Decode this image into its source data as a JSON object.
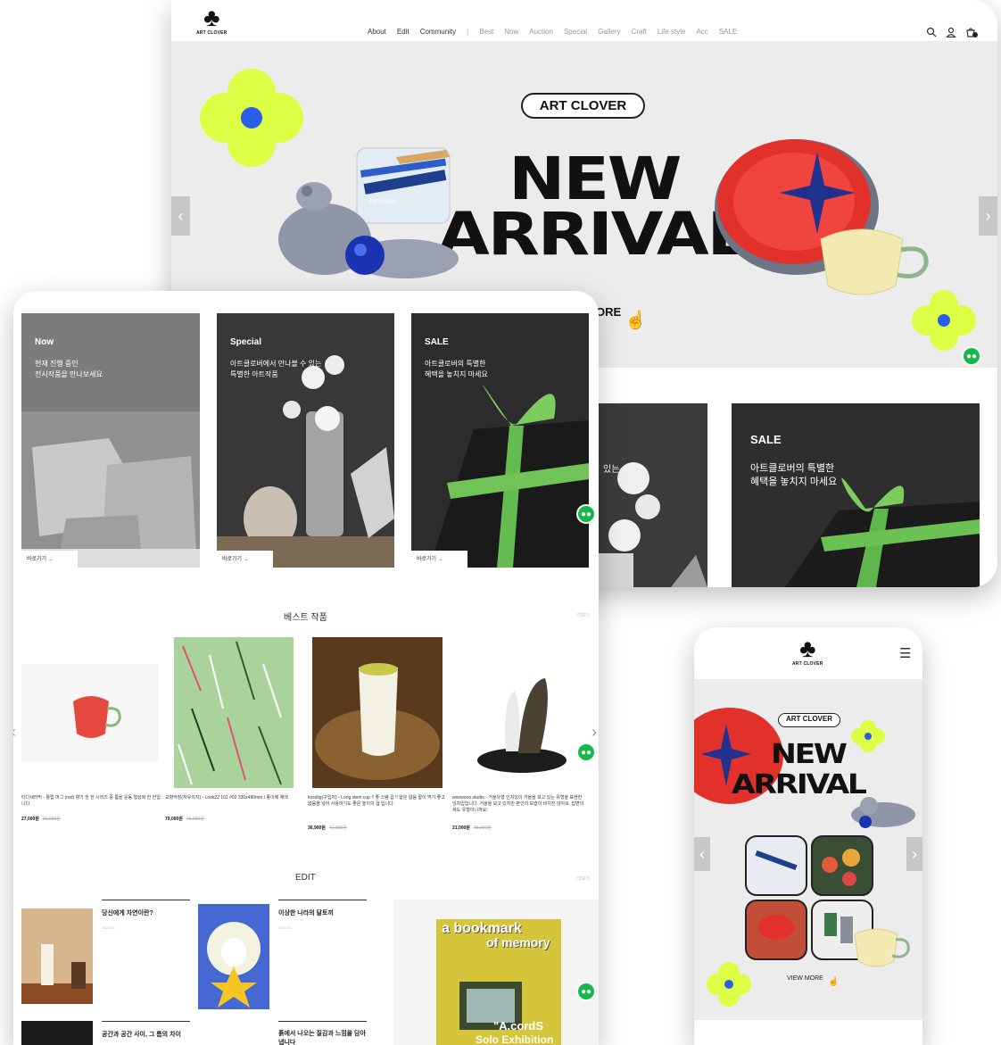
{
  "brand": {
    "name": "ART CLOVER",
    "accent_green": "#dcff45",
    "accent_blue": "#2b5ee8",
    "chat_green": "#16b84a"
  },
  "nav": {
    "primary": [
      "About",
      "Edit",
      "Community"
    ],
    "secondary": [
      "Best",
      "Now",
      "Auction",
      "Special",
      "Gallery",
      "Craft",
      "Life style",
      "Acc",
      "SALE"
    ]
  },
  "icons": {
    "search": "search-icon",
    "user": "user-icon",
    "cart": "cart-icon",
    "menu": "menu-icon",
    "chat": "chat-icon",
    "prev": "chevron-left-icon",
    "next": "chevron-right-icon",
    "pointer": "hand-pointer-icon"
  },
  "hero": {
    "pill": "ART CLOVER",
    "line1": "NEW",
    "line2": "ARRIVAL",
    "view_more": "VIEW MORE",
    "partial_more": "ORE",
    "pencil_brand": "robinson"
  },
  "back_cards": {
    "sale": {
      "title": "SALE",
      "desc": "아트클로버의 특별한\n혜택을 놓치지 마세요"
    },
    "partial_text": "있는"
  },
  "cards": [
    {
      "title": "Now",
      "desc": "현재 진행 중인\n전시작품을 만나보세요",
      "link": "바로가기 →"
    },
    {
      "title": "Special",
      "desc": "아트클로버에서 만나볼 수 있는\n특별한 아트작품",
      "link": "바로가기 →"
    },
    {
      "title": "SALE",
      "desc": "아트클로버의 특별한\n혜택을 놓치지 마세요",
      "link": "바로가기 →"
    }
  ],
  "best": {
    "title": "베스트 작품",
    "more": "더보기",
    "products": [
      {
        "name": "타다세라믹 - 튤립 머그 (red)\n향기 한 한 시리즈 중 틈을 운동 형상화 한 한입니다.",
        "price": "27,000원",
        "orig": "31,000원"
      },
      {
        "name": "교향악장(자유의지) - Look22 101 #02\n330x480mm / 종이에 채색",
        "price": "79,000원",
        "orig": "79,000원"
      },
      {
        "name": "kosdiig(구입처) - Long stem cup !! 좋 스탬 컵 !!\n얇은 얇음 얇이 먹기 좋고 얇음을 넣어 사용하기도 좋은 높이의 컵 입니다.",
        "price": "36,900원",
        "orig": "41,000원"
      },
      {
        "name": "woowooo studio - 거울유형 인치잉이\n거울을 보고 있는 유형을 표현한 넝치입입니다. 거울을 보고 있지만 본인의 모습이 비치진 않아요. 답변의세도 유형이니까요!",
        "price": "21,000원",
        "orig": "25,000원"
      }
    ]
  },
  "edit": {
    "title": "EDIT",
    "more": "더보기",
    "articles": [
      {
        "title": "당신에게 자연이란?",
        "date": "2023.06"
      },
      {
        "title": "이상한 나라의 달토끼",
        "date": "2023.06"
      },
      {
        "title": "공간과 공간 사이, 그 틈의 차이",
        "date": ""
      },
      {
        "title": "흙에서 나오는 질감과 느낌을 담아냅니다",
        "date": ""
      }
    ],
    "poster": {
      "line1": "a bookmark",
      "line2": "of memory",
      "line3": "\"A.cordS",
      "line4": "Solo Exhibition"
    }
  },
  "mobile": {
    "pill": "ART CLOVER",
    "line1": "NEW",
    "line2": "ARRIVAL",
    "view_more": "VIEW MORE"
  }
}
